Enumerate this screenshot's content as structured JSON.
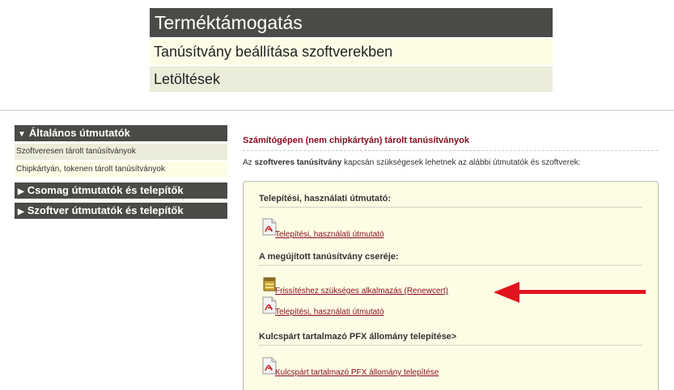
{
  "header": {
    "title": "Terméktámogatás",
    "row1": "Tanúsítvány beállítása szoftverekben",
    "row2": "Letöltések"
  },
  "sidebar": {
    "sections": [
      {
        "label": "Általános útmutatók",
        "expanded": true,
        "icon": "triangle-down-icon"
      },
      {
        "label": "Csomag útmutatók és telepítők",
        "expanded": false,
        "icon": "triangle-right-icon"
      },
      {
        "label": "Szoftver útmutatók és telepítők",
        "expanded": false,
        "icon": "triangle-right-icon"
      }
    ],
    "items": [
      {
        "label": "Szoftveresen tárolt tanúsítványok"
      },
      {
        "label": "Chipkártyán, tokenen tárolt tanúsítványok"
      }
    ]
  },
  "main": {
    "title": "Számítógépen (nem chipkártyán) tárolt tanúsítványok",
    "intro_pre": "Az ",
    "intro_bold": "szoftveres tanúsítvány",
    "intro_post": " kapcsán szükségesek lehetnek az alábbi útmutatók és szoftverek:",
    "sections": [
      {
        "title": "Telepítési, használati útmutató:",
        "links": [
          {
            "label": "Telepítési, használati útmutató",
            "icon": "pdf-icon"
          }
        ]
      },
      {
        "title": "A megújított tanúsítvány cseréje:",
        "links": [
          {
            "label": "Frissítéshez szükséges alkalmazás (Renewcert)",
            "icon": "application-icon"
          },
          {
            "label": "Telepítési, használati útmutató",
            "icon": "pdf-icon"
          }
        ]
      },
      {
        "title": "Kulcspárt tartalmazó PFX állomány telepítése>",
        "links": [
          {
            "label": "Kulcspárt tartalmazó PFX állomány telepítése",
            "icon": "pdf-icon"
          }
        ]
      }
    ]
  },
  "colors": {
    "header_dark": "#4a4a46",
    "row_light": "#fdfde6",
    "row_beige": "#ececda",
    "link_color": "#8a0b1f",
    "arrow_red": "#e0141e"
  }
}
